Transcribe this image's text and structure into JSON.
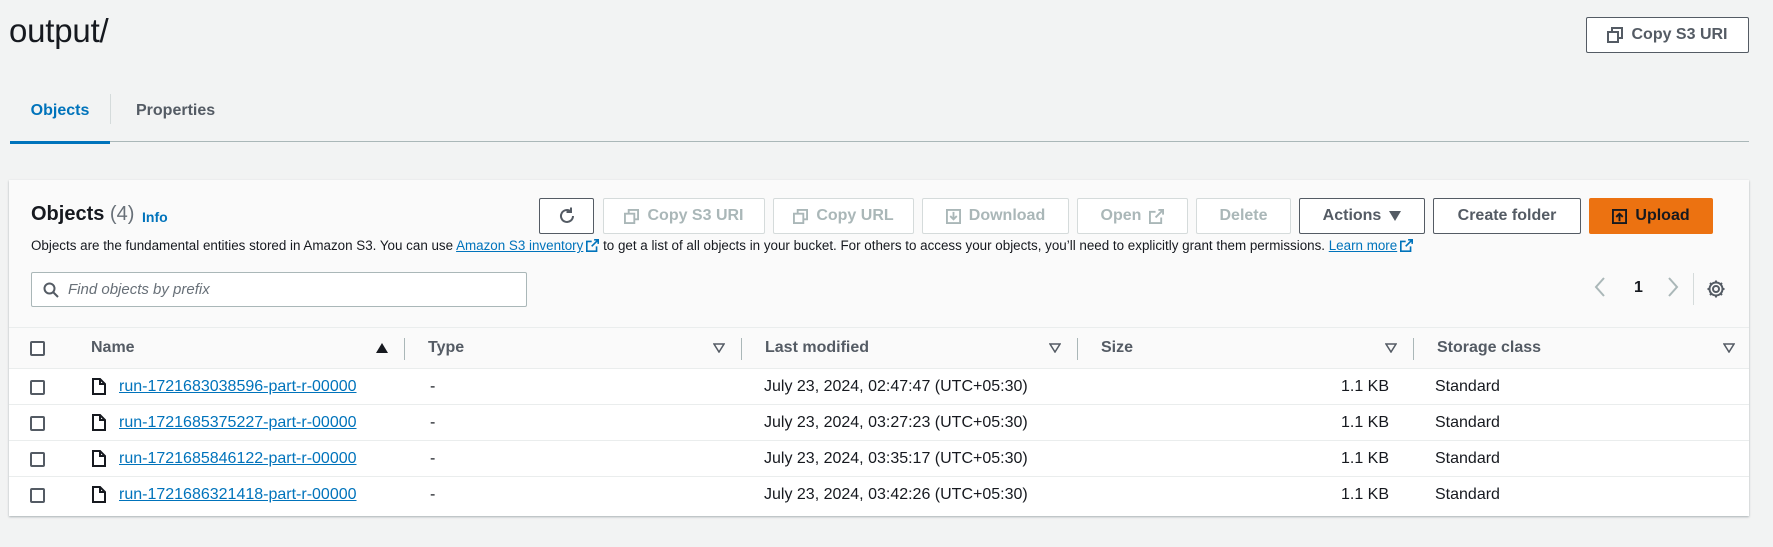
{
  "header": {
    "title": "output/",
    "copy_s3_uri": "Copy S3 URI"
  },
  "tabs": [
    {
      "label": "Objects",
      "active": true
    },
    {
      "label": "Properties",
      "active": false
    }
  ],
  "objects_panel": {
    "title": "Objects",
    "count": "(4)",
    "info": "Info",
    "desc_before": "Objects are the fundamental entities stored in Amazon S3. You can use ",
    "desc_link1": "Amazon S3 inventory",
    "desc_middle": " to get a list of all objects in your bucket. For others to access your objects, you’ll need to explicitly grant them permissions. ",
    "desc_link2": "Learn more",
    "buttons": {
      "copy_s3_uri": "Copy S3 URI",
      "copy_url": "Copy URL",
      "download": "Download",
      "open": "Open",
      "delete": "Delete",
      "actions": "Actions",
      "create_folder": "Create folder",
      "upload": "Upload"
    },
    "search_placeholder": "Find objects by prefix",
    "page": "1"
  },
  "table": {
    "columns": [
      "Name",
      "Type",
      "Last modified",
      "Size",
      "Storage class"
    ],
    "rows": [
      {
        "name": "run-1721683038596-part-r-00000",
        "type": "-",
        "last_modified": "July 23, 2024, 02:47:47 (UTC+05:30)",
        "size": "1.1 KB",
        "storage_class": "Standard"
      },
      {
        "name": "run-1721685375227-part-r-00000",
        "type": "-",
        "last_modified": "July 23, 2024, 03:27:23 (UTC+05:30)",
        "size": "1.1 KB",
        "storage_class": "Standard"
      },
      {
        "name": "run-1721685846122-part-r-00000",
        "type": "-",
        "last_modified": "July 23, 2024, 03:35:17 (UTC+05:30)",
        "size": "1.1 KB",
        "storage_class": "Standard"
      },
      {
        "name": "run-1721686321418-part-r-00000",
        "type": "-",
        "last_modified": "July 23, 2024, 03:42:26 (UTC+05:30)",
        "size": "1.1 KB",
        "storage_class": "Standard"
      }
    ]
  },
  "colors": {
    "link": "#0073bb",
    "upload": "#ec7211",
    "background": "#f2f3f3"
  }
}
